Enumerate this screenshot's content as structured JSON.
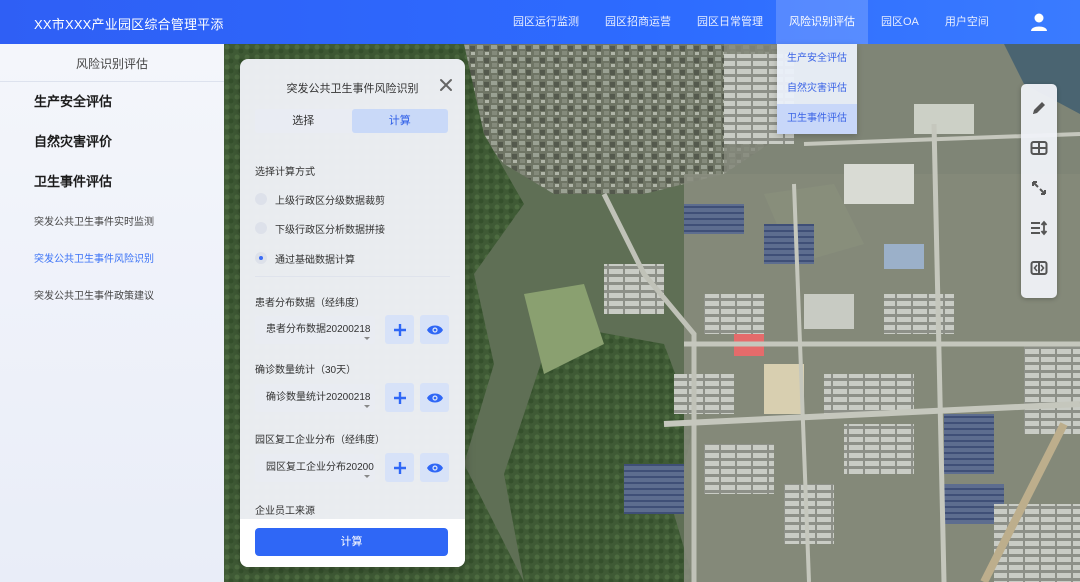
{
  "header": {
    "app_title": "XX市XXX产业园区综合管理平添",
    "nav": [
      {
        "label": "园区运行监测"
      },
      {
        "label": "园区招商运营"
      },
      {
        "label": "园区日常管理"
      },
      {
        "label": "风险识别评估"
      },
      {
        "label": "园区OA"
      },
      {
        "label": "用户空间"
      }
    ],
    "active_nav": "风险识别评估",
    "user_icon": "user-icon"
  },
  "dropdown": {
    "items": [
      {
        "label": "生产安全评估"
      },
      {
        "label": "自然灾害评估"
      },
      {
        "label": "卫生事件评估"
      }
    ],
    "selected": "卫生事件评估"
  },
  "sidebar": {
    "title": "风险识别评估",
    "items": [
      {
        "label": "生产安全评估"
      },
      {
        "label": "自然灾害评价"
      },
      {
        "label": "卫生事件评估"
      },
      {
        "label": "突发公共卫生事件实时监测"
      },
      {
        "label": "突发公共卫生事件风险识别"
      },
      {
        "label": "突发公共卫生事件政策建议"
      }
    ],
    "active_item": "突发公共卫生事件风险识别"
  },
  "panel": {
    "title": "突发公共卫生事件风险识别",
    "tabs": [
      {
        "label": "选择"
      },
      {
        "label": "计算"
      }
    ],
    "active_tab": "计算",
    "method_label": "选择计算方式",
    "methods": [
      {
        "label": "上级行政区分级数据裁剪",
        "checked": false
      },
      {
        "label": "下级行政区分析数据拼接",
        "checked": false
      },
      {
        "label": "通过基础数据计算",
        "checked": true
      }
    ],
    "datasets": [
      {
        "label": "患者分布数据（经纬度）",
        "value": "患者分布数据20200218"
      },
      {
        "label": "确诊数量统计（30天）",
        "value": "确诊数量统计20200218"
      },
      {
        "label": "园区复工企业分布（经纬度）",
        "value": "园区复工企业分布20200"
      }
    ],
    "next_label": "企业员工来源",
    "add_icon": "plus-icon",
    "view_icon": "eye-icon",
    "calc_button": "计算"
  },
  "toolbar": {
    "tools": [
      "pencil-icon",
      "grid-icon",
      "expand-icon",
      "sort-icon",
      "compare-icon"
    ]
  },
  "colors": {
    "primary": "#2f67f6",
    "header_start": "#2f5ff5",
    "active_text": "#3b72f6"
  }
}
